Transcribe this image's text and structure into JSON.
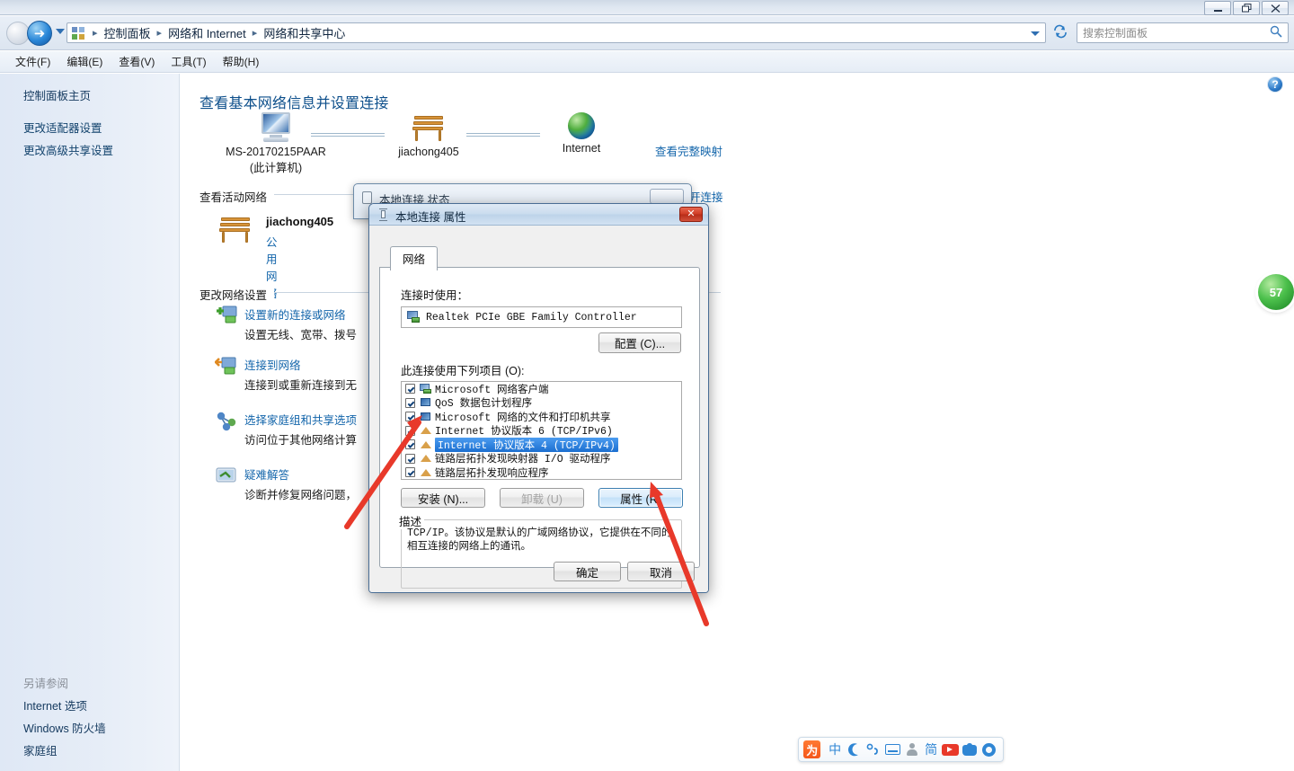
{
  "window": {
    "minimize_label": "minimize",
    "restore_label": "restore",
    "close_label": "close"
  },
  "address": {
    "breadcrumbs": [
      "控制面板",
      "网络和 Internet",
      "网络和共享中心"
    ],
    "separator": "▸",
    "refresh_label": "↻"
  },
  "search": {
    "placeholder": "搜索控制面板"
  },
  "menu": {
    "items": [
      "文件(F)",
      "编辑(E)",
      "查看(V)",
      "工具(T)",
      "帮助(H)"
    ]
  },
  "sidebar": {
    "home": "控制面板主页",
    "items": [
      "更改适配器设置",
      "更改高级共享设置"
    ],
    "see_also_header": "另请参阅",
    "see_also": [
      "Internet 选项",
      "Windows 防火墙",
      "家庭组"
    ]
  },
  "main": {
    "help_label": "?",
    "page_title": "查看基本网络信息并设置连接",
    "network_map": {
      "nodes": [
        {
          "label": "MS-20170215PAAR",
          "sublabel": "(此计算机)",
          "icon": "computer-icon"
        },
        {
          "label": "jiachong405",
          "sublabel": "",
          "icon": "bench-network-icon"
        },
        {
          "label": "Internet",
          "sublabel": "",
          "icon": "globe-icon"
        }
      ],
      "full_map_link": "查看完整映射"
    },
    "active_networks_header": "查看活动网络",
    "active_network": {
      "name": "jiachong405",
      "type": "公用网络",
      "access_label": "开连接"
    },
    "change_settings_header": "更改网络设置",
    "tasks": [
      {
        "link": "设置新的连接或网络",
        "desc": "设置无线、宽带、拨号",
        "icon": "new-connection-icon"
      },
      {
        "link": "连接到网络",
        "desc": "连接到或重新连接到无",
        "icon": "connect-network-icon"
      },
      {
        "link": "选择家庭组和共享选项",
        "desc": "访问位于其他网络计算",
        "icon": "homegroup-icon"
      },
      {
        "link": "疑难解答",
        "desc": "诊断并修复网络问题，",
        "icon": "troubleshoot-icon"
      }
    ]
  },
  "status_dialog": {
    "title": "本地连接 状态",
    "close_label": "✕"
  },
  "properties_dialog": {
    "title": "本地连接 属性",
    "close_label": "✕",
    "tab": "网络",
    "connect_using_label": "连接时使用：",
    "adapter": "Realtek PCIe GBE Family Controller",
    "configure_button": "配置 (C)...",
    "items_label": "此连接使用下列项目 (O):",
    "items": [
      {
        "label": "Microsoft 网络客户端",
        "checked": true,
        "selected": false,
        "icon": "client-icon"
      },
      {
        "label": "QoS 数据包计划程序",
        "checked": true,
        "selected": false,
        "icon": "service-icon"
      },
      {
        "label": "Microsoft 网络的文件和打印机共享",
        "checked": true,
        "selected": false,
        "icon": "service-icon"
      },
      {
        "label": "Internet 协议版本 6 (TCP/IPv6)",
        "checked": true,
        "selected": false,
        "icon": "protocol-icon"
      },
      {
        "label": "Internet 协议版本 4 (TCP/IPv4)",
        "checked": true,
        "selected": true,
        "icon": "protocol-icon"
      },
      {
        "label": "链路层拓扑发现映射器 I/O 驱动程序",
        "checked": true,
        "selected": false,
        "icon": "protocol-icon"
      },
      {
        "label": "链路层拓扑发现响应程序",
        "checked": true,
        "selected": false,
        "icon": "protocol-icon"
      }
    ],
    "install_button": "安装 (N)...",
    "uninstall_button": "卸载 (U)",
    "properties_button": "属性 (R)",
    "description_legend": "描述",
    "description_text": "TCP/IP。该协议是默认的广域网络协议，它提供在不同的相互连接的网络上的通讯。",
    "ok_button": "确定",
    "cancel_button": "取消"
  },
  "overlay": {
    "green_badge": "57",
    "arrow_color": "#e8392a"
  },
  "ime_toolbar": {
    "logo": "为",
    "mode": "中",
    "icons": [
      "moon-icon",
      "comma-icon",
      "keyboard-icon",
      "person-icon",
      "simplified-icon",
      "video-icon",
      "shirt-icon",
      "gear-icon"
    ],
    "simplified": "简"
  },
  "colors": {
    "accent": "#1466ab",
    "title_blue": "#0d4f8b",
    "selection": "#1b6fd0",
    "red": "#e8392a",
    "green": "#2f9e34"
  }
}
